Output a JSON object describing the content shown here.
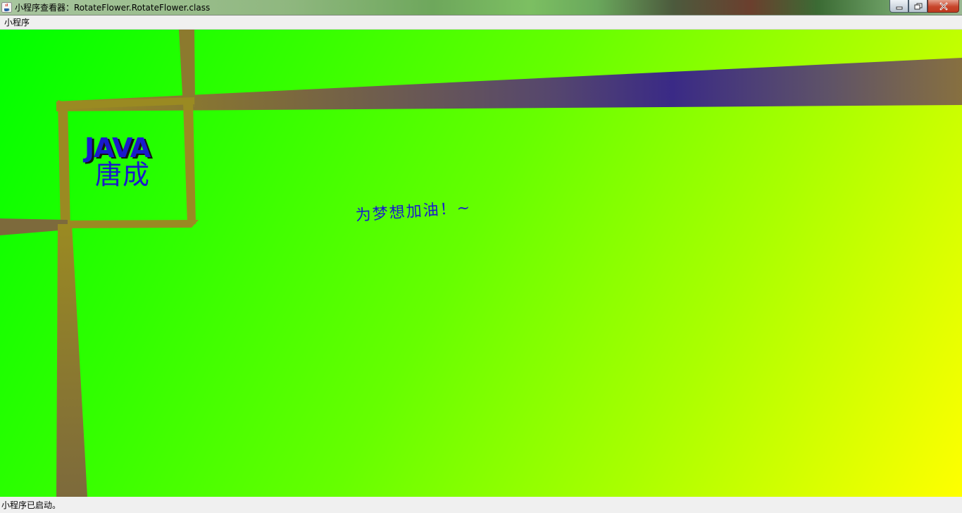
{
  "window": {
    "title": "小程序查看器：RotateFlower.RotateFlower.class",
    "app_icon": "java-cup-icon",
    "controls": [
      "minimize-icon",
      "restore-icon",
      "close-icon"
    ]
  },
  "menubar": {
    "items": [
      {
        "label": "小程序"
      }
    ]
  },
  "applet": {
    "java_label": "JAVA",
    "name_label": "唐成",
    "slogan": "为梦想加油！~",
    "colors": {
      "gradient_start": "#00ff00",
      "gradient_end": "#ffff00",
      "bar_tan": "#9a8a22",
      "bar_olive": "#7d6a3c",
      "bar_indigo": "#3a2a86",
      "text_blue": "#1a1acc"
    }
  },
  "statusbar": {
    "text": "小程序已启动。"
  }
}
